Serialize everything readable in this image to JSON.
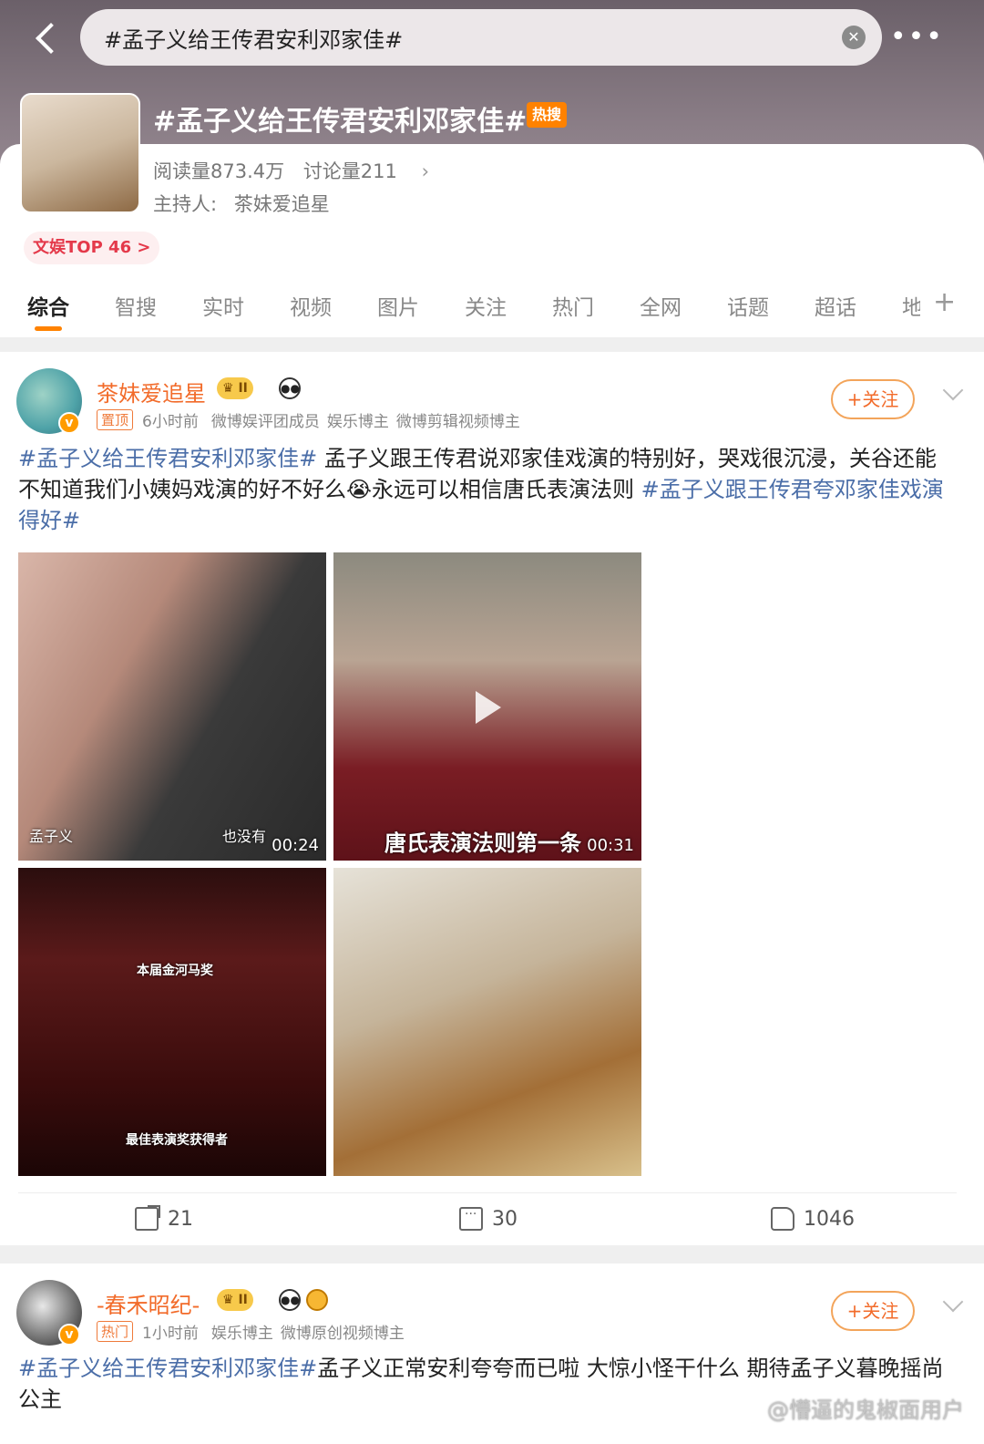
{
  "search": {
    "query": "#孟子义给王传君安利邓家佳#"
  },
  "topic": {
    "title": "#孟子义给王传君安利邓家佳#",
    "hot_badge": "热搜",
    "reads": "阅读量873.4万",
    "discussions": "讨论量211",
    "host_label": "主持人:",
    "host": "茶妹爱追星",
    "rank": "文娱TOP 46 >"
  },
  "tabs": [
    "综合",
    "智搜",
    "实时",
    "视频",
    "图片",
    "关注",
    "热门",
    "全网",
    "话题",
    "超话",
    "地"
  ],
  "posts": [
    {
      "username": "茶妹爱追星",
      "level": "II",
      "tag": "置顶",
      "time": "6小时前",
      "descs": [
        "微博娱评团成员",
        "娱乐博主",
        "微博剪辑视频博主"
      ],
      "follow": "+关注",
      "text_tag1": "#孟子义给王传君安利邓家佳#",
      "text_body": " 孟子义跟王传君说邓家佳戏演的特别好，哭戏很沉浸，关谷还能不知道我们小姨妈戏演的好不好么😭永远可以相信唐氏表演法则 ",
      "text_tag2": "#孟子义跟王传君夸邓家佳戏演得好#",
      "media": [
        {
          "caption_left": "孟子义",
          "caption_right": "也没有",
          "duration": "00:24"
        },
        {
          "subtitle": "唐氏表演法则第一条",
          "duration": "00:31"
        },
        {
          "subtitle_top": "本届金河马奖",
          "subtitle_bottom": "最佳表演奖获得者"
        },
        {}
      ],
      "shares": "21",
      "comments": "30",
      "likes": "1046"
    },
    {
      "username": "-春禾昭纪-",
      "level": "II",
      "tag": "热门",
      "time": "1小时前",
      "descs": [
        "娱乐博主",
        "微博原创视频博主"
      ],
      "follow": "+关注",
      "text_tag1": "#孟子义给王传君安利邓家佳#",
      "text_body": "孟子义正常安利夸夸而已啦 大惊小怪干什么 期待孟子义暮晚摇尚公主"
    }
  ],
  "watermark": "@懵逼的鬼椒面用户"
}
